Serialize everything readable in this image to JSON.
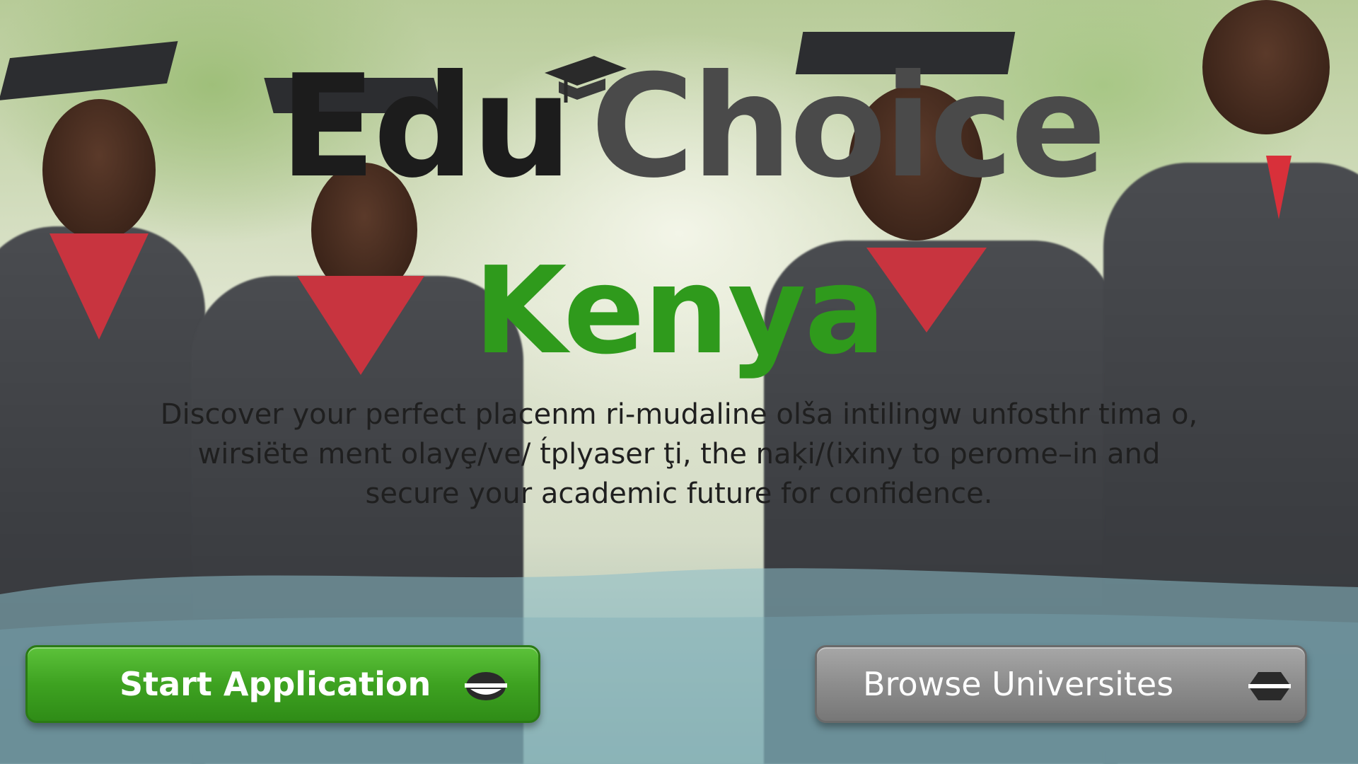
{
  "brand": {
    "name_part1": "Edu",
    "name_part2": "Choice",
    "logo_icon": "graduation-cap-icon",
    "colors": {
      "part1": "#1c1c1c",
      "part2": "#4a4a4a"
    }
  },
  "hero": {
    "country": "Kenya",
    "country_color": "#2f9a1c",
    "tagline_lines": [
      "Discover your perfect placenm ri-mudaline olša intilingw unfosthr tima o,",
      "wirsiëte ment olayȩ/ve/ t́plyaser ţi, the naķi/(ixiny to perome–in and",
      "secure your academic future for confidence."
    ]
  },
  "actions": {
    "start": {
      "label": "Start Application",
      "icon": "chevron-down-icon",
      "color": "#3ea221"
    },
    "browse": {
      "label": "Browse Universites",
      "icon": "chevron-right-icon",
      "color": "#8d8d8d"
    }
  }
}
